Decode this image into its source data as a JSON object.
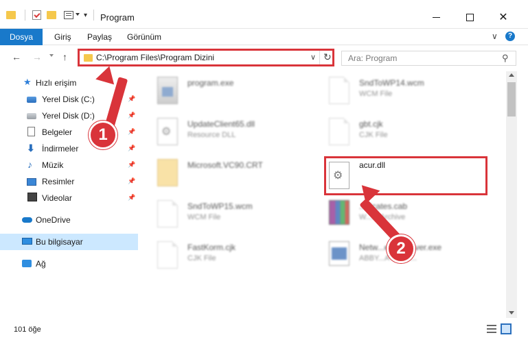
{
  "window": {
    "title": "Program",
    "minimize_label": "",
    "close_label": "✕"
  },
  "ribbon": {
    "tabs": [
      "Dosya",
      "Giriş",
      "Paylaş",
      "Görünüm"
    ],
    "chevron": "∨",
    "help": "?"
  },
  "nav": {
    "back": "←",
    "forward": "→",
    "up": "↑",
    "address": "C:\\Program Files\\Program Dizini",
    "address_dropdown": "∨",
    "refresh": "↻",
    "search_placeholder": "Ara: Program",
    "search_glyph": "⚲"
  },
  "sidebar": {
    "items": [
      {
        "label": "Hızlı erişim",
        "icon": "star-icon"
      },
      {
        "label": "Yerel Disk (C:)",
        "icon": "drive-icon",
        "pinned": true
      },
      {
        "label": "Yerel Disk (D:)",
        "icon": "drive-icon",
        "pinned": true
      },
      {
        "label": "Belgeler",
        "icon": "documents-icon",
        "pinned": true
      },
      {
        "label": "İndirmeler",
        "icon": "downloads-icon",
        "pinned": true
      },
      {
        "label": "Müzik",
        "icon": "music-icon",
        "pinned": true
      },
      {
        "label": "Resimler",
        "icon": "pictures-icon",
        "pinned": true
      },
      {
        "label": "Videolar",
        "icon": "videos-icon",
        "pinned": true
      },
      {
        "label": "OneDrive",
        "icon": "cloud-icon"
      },
      {
        "label": "Bu bilgisayar",
        "icon": "computer-icon",
        "selected": true
      },
      {
        "label": "Ağ",
        "icon": "network-icon"
      }
    ],
    "pin_glyph": "📌"
  },
  "files": [
    {
      "name": "program.exe",
      "type": "",
      "icon": "exe-icon"
    },
    {
      "name": "SndToWP14.wcm",
      "type": "WCM File",
      "icon": "document-icon"
    },
    {
      "name": "UpdateClient65.dll",
      "type": "Resource DLL",
      "icon": "dll-icon"
    },
    {
      "name": "gbt.cjk",
      "type": "CJK File",
      "icon": "document-icon"
    },
    {
      "name": "Microsoft.VC90.CRT",
      "type": "",
      "icon": "folder-icon"
    },
    {
      "name": "acur.dll",
      "type": "",
      "icon": "dll-icon"
    },
    {
      "name": "SndToWP15.wcm",
      "type": "WCM File",
      "icon": "document-icon"
    },
    {
      "name": "...ificates.cab",
      "type": "W...M Archive",
      "icon": "archive-icon"
    },
    {
      "name": "FastKorm.cjk",
      "type": "CJK File",
      "icon": "document-icon"
    },
    {
      "name": "Netw...enseServer.exe",
      "type": "ABBY...A licens...",
      "icon": "application-icon"
    }
  ],
  "callouts": {
    "step1": "1",
    "step2": "2",
    "accent_color": "#d9343a"
  },
  "status": {
    "item_count": "101 öğe"
  }
}
